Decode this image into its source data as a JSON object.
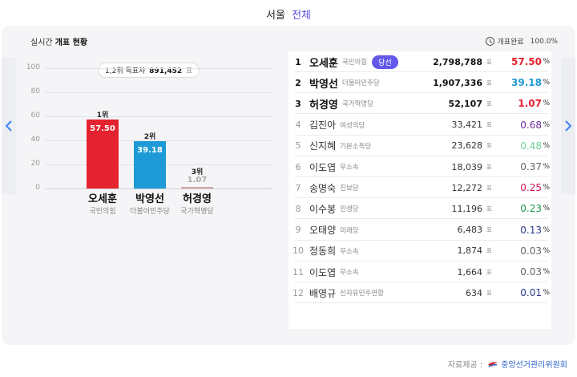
{
  "header": {
    "region": "서울",
    "scope": "전체"
  },
  "panel": {
    "title_prefix": "실시간",
    "title_bold": "개표 현황",
    "status_label": "개표완료",
    "status_value": "100.0%"
  },
  "chart": {
    "gap_label": "1,2위 득표차",
    "gap_value": "891,452",
    "gap_unit": "표",
    "yticks": [
      "100",
      "80",
      "60",
      "40",
      "20",
      "0"
    ]
  },
  "chart_data": {
    "type": "bar",
    "categories": [
      "오세훈",
      "박영선",
      "허경영"
    ],
    "parties": [
      "국민의힘",
      "더불어민주당",
      "국가혁명당"
    ],
    "ranks": [
      "1위",
      "2위",
      "3위"
    ],
    "values": [
      57.5,
      39.18,
      1.07
    ],
    "value_labels": [
      "57.50",
      "39.18",
      "1.07"
    ],
    "colors": [
      "#e5222f",
      "#1e9bd7",
      "#d9a5a5"
    ],
    "ylim": [
      0,
      100
    ]
  },
  "results": [
    {
      "rank": "1",
      "name": "오세훈",
      "party": "국민의힘",
      "badge": "당선",
      "votes": "2,798,788",
      "unit": "표",
      "pct": "57.50",
      "pct_unit": "%",
      "color": "#e5222f"
    },
    {
      "rank": "2",
      "name": "박영선",
      "party": "더불어민주당",
      "votes": "1,907,336",
      "unit": "표",
      "pct": "39.18",
      "pct_unit": "%",
      "color": "#1e9bd7"
    },
    {
      "rank": "3",
      "name": "허경영",
      "party": "국가혁명당",
      "votes": "52,107",
      "unit": "표",
      "pct": "1.07",
      "pct_unit": "%",
      "color": "#e5222f"
    },
    {
      "rank": "4",
      "name": "김진아",
      "party": "여성의당",
      "votes": "33,421",
      "unit": "표",
      "pct": "0.68",
      "pct_unit": "%",
      "color": "#6b2f9e"
    },
    {
      "rank": "5",
      "name": "신지혜",
      "party": "기본소득당",
      "votes": "23,628",
      "unit": "표",
      "pct": "0.48",
      "pct_unit": "%",
      "color": "#6fcf97"
    },
    {
      "rank": "6",
      "name": "이도엽",
      "party": "무소속",
      "votes": "18,039",
      "unit": "표",
      "pct": "0.37",
      "pct_unit": "%",
      "color": "#666666"
    },
    {
      "rank": "7",
      "name": "송명숙",
      "party": "진보당",
      "votes": "12,272",
      "unit": "표",
      "pct": "0.25",
      "pct_unit": "%",
      "color": "#d4145a"
    },
    {
      "rank": "8",
      "name": "이수봉",
      "party": "민생당",
      "votes": "11,196",
      "unit": "표",
      "pct": "0.23",
      "pct_unit": "%",
      "color": "#1a9a4a"
    },
    {
      "rank": "9",
      "name": "오태양",
      "party": "미래당",
      "votes": "6,483",
      "unit": "표",
      "pct": "0.13",
      "pct_unit": "%",
      "color": "#2b3a8c"
    },
    {
      "rank": "10",
      "name": "정동희",
      "party": "무소속",
      "votes": "1,874",
      "unit": "표",
      "pct": "0.03",
      "pct_unit": "%",
      "color": "#666666"
    },
    {
      "rank": "11",
      "name": "이도엽",
      "party": "무소속",
      "votes": "1,664",
      "unit": "표",
      "pct": "0.03",
      "pct_unit": "%",
      "color": "#666666"
    },
    {
      "rank": "12",
      "name": "배영규",
      "party": "신자유민주연합",
      "votes": "634",
      "unit": "표",
      "pct": "0.01",
      "pct_unit": "%",
      "color": "#2b3a8c"
    }
  ],
  "footer": {
    "label": "자료제공 :",
    "org": "중앙선거관리위원회"
  }
}
